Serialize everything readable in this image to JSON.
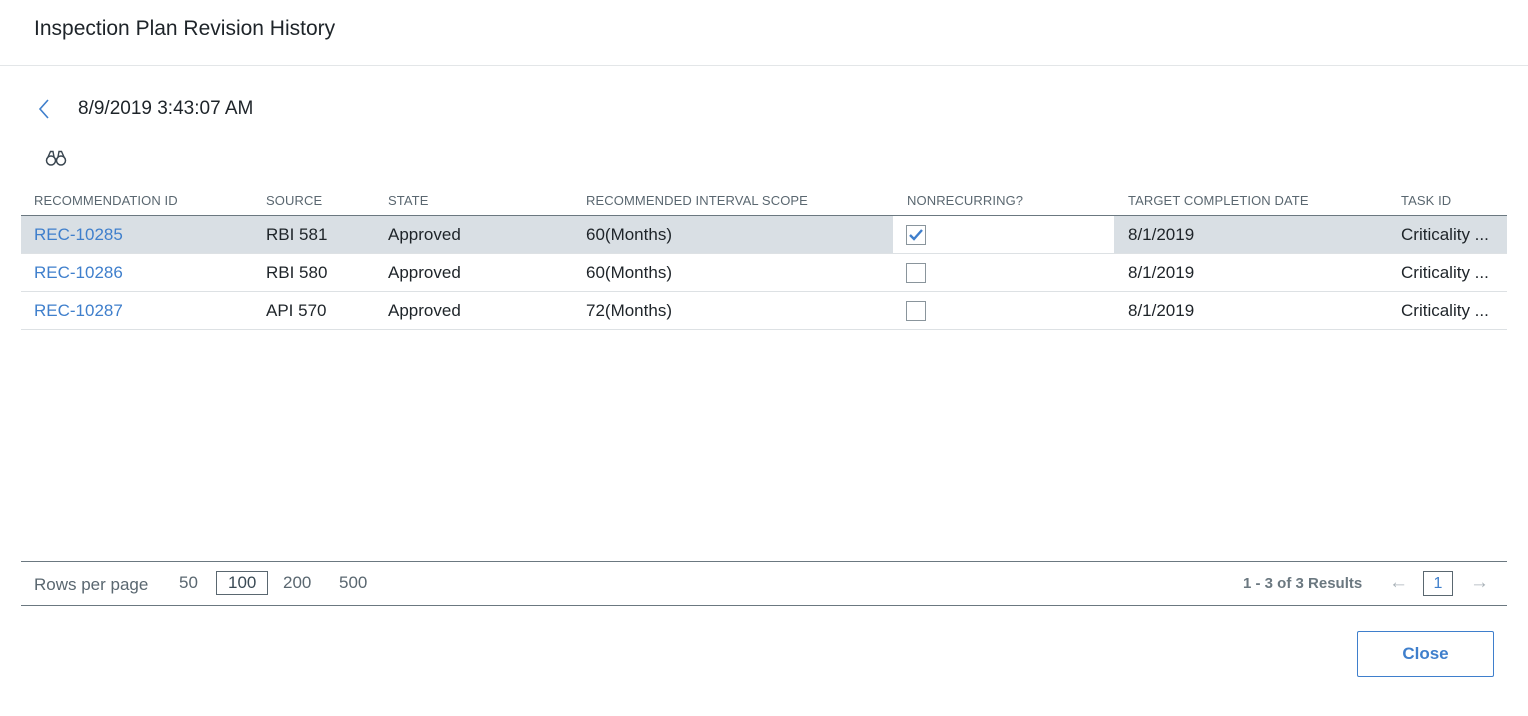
{
  "dialog": {
    "title": "Inspection Plan Revision History",
    "revision_date": "8/9/2019 3:43:07 AM"
  },
  "grid": {
    "columns": [
      "RECOMMENDATION ID",
      "SOURCE",
      "STATE",
      "RECOMMENDED INTERVAL SCOPE",
      "NONRECURRING?",
      "TARGET COMPLETION DATE",
      "TASK ID"
    ],
    "rows": [
      {
        "id": "REC-10285",
        "source": "RBI 581",
        "state": "Approved",
        "scope": "60(Months)",
        "nonrecurring": true,
        "date": "8/1/2019",
        "task": "Criticality ..."
      },
      {
        "id": "REC-10286",
        "source": "RBI 580",
        "state": "Approved",
        "scope": "60(Months)",
        "nonrecurring": false,
        "date": "8/1/2019",
        "task": "Criticality ..."
      },
      {
        "id": "REC-10287",
        "source": "API 570",
        "state": "Approved",
        "scope": "72(Months)",
        "nonrecurring": false,
        "date": "8/1/2019",
        "task": "Criticality ..."
      }
    ]
  },
  "pager": {
    "rows_per_page_label": "Rows per page",
    "sizes": [
      "50",
      "100",
      "200",
      "500"
    ],
    "active_size": "100",
    "results": "1 - 3 of 3 Results",
    "prev_icon": "←",
    "next_icon": "→",
    "page": "1"
  },
  "footer": {
    "close_label": "Close"
  },
  "colors": {
    "accent": "#3f7fcc",
    "selected_row": "#d9dfe4",
    "text": "#1e2429"
  },
  "icons": {
    "back": "chevron-left-icon",
    "find": "binoculars-icon",
    "check": "checkmark-icon"
  }
}
